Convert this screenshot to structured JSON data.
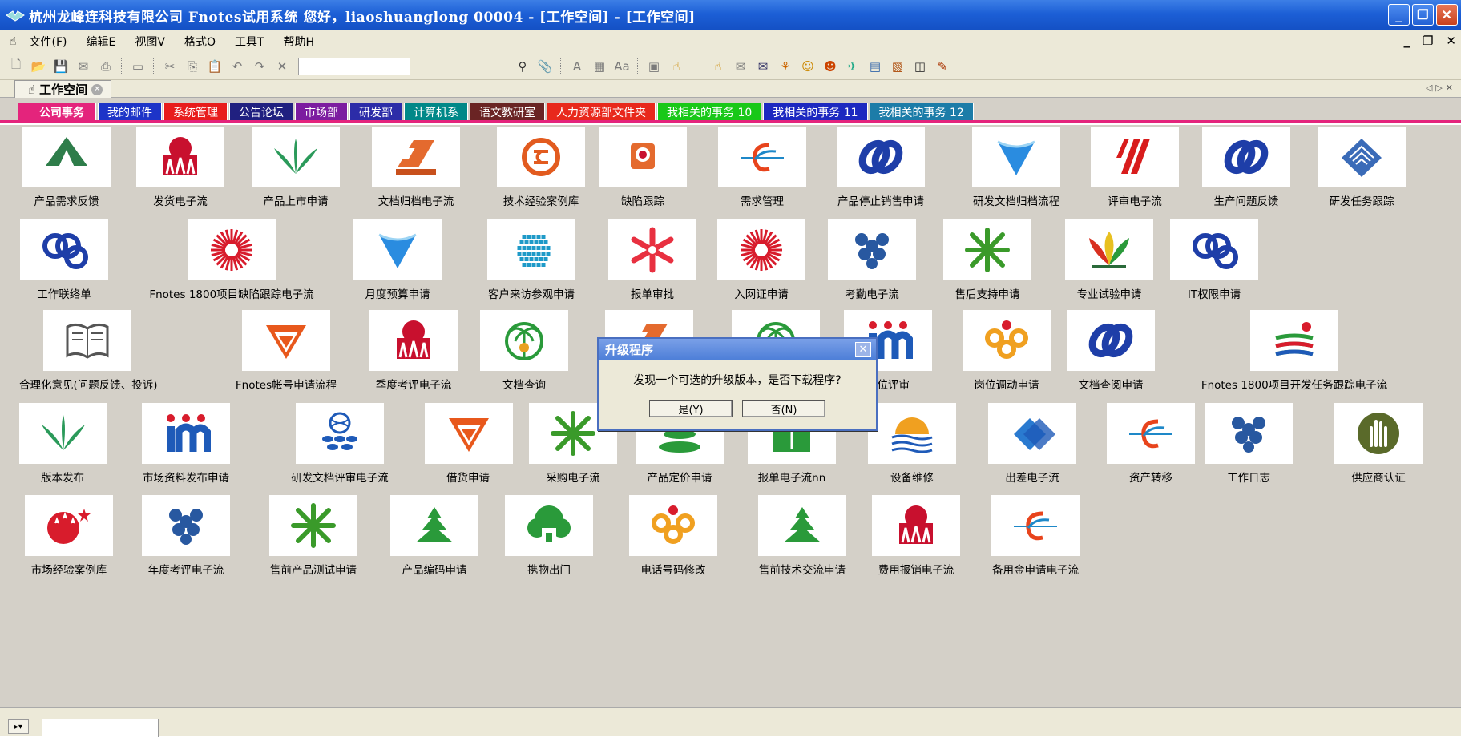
{
  "window": {
    "title": "杭州龙峰连科技有限公司 Fnotes试用系统 您好，liaoshuanglong 00004 - [工作空间] - [工作空间]"
  },
  "menu": [
    "文件(F)",
    "编辑E",
    "视图V",
    "格式O",
    "工具T",
    "帮助H"
  ],
  "doc_tab": "工作空间",
  "categories": [
    {
      "label": "公司事务",
      "color": "#e4247c"
    },
    {
      "label": "我的邮件",
      "color": "#1d34c8"
    },
    {
      "label": "系统管理",
      "color": "#e81c1c"
    },
    {
      "label": "公告论坛",
      "color": "#202080"
    },
    {
      "label": "市场部",
      "color": "#7c1ca0"
    },
    {
      "label": "研发部",
      "color": "#2c2ca8"
    },
    {
      "label": "计算机系",
      "color": "#008888"
    },
    {
      "label": "语文教研室",
      "color": "#6a2424"
    },
    {
      "label": "人力资源部文件夹",
      "color": "#e8281c"
    },
    {
      "label": "我相关的事务 10",
      "color": "#18c818"
    },
    {
      "label": "我相关的事务 11",
      "color": "#1c28c0"
    },
    {
      "label": "我相关的事务 12",
      "color": "#1c7ca8"
    }
  ],
  "rows": [
    [
      {
        "label": "产品需求反馈",
        "icon": "tree-logo-icon"
      },
      {
        "label": "发货电子流",
        "icon": "castle-logo-icon"
      },
      {
        "label": "产品上市申请",
        "icon": "leaves-logo-icon"
      },
      {
        "label": "文档归档电子流",
        "icon": "film-logo-icon"
      },
      {
        "label": "技术经验案例库",
        "icon": "ring-logo-icon"
      },
      {
        "label": "缺陷跟踪",
        "icon": "rose-logo-icon"
      },
      {
        "label": "需求管理",
        "icon": "wave-logo-icon"
      },
      {
        "label": "产品停止销售申请",
        "icon": "blue-rings-icon"
      },
      {
        "label": "研发文档归档流程",
        "icon": "blue-triangle-icon"
      },
      {
        "label": "评审电子流",
        "icon": "red-stripes-icon"
      },
      {
        "label": "生产问题反馈",
        "icon": "blue-rings-icon"
      },
      {
        "label": "研发任务跟踪",
        "icon": "blue-diamond-icon"
      }
    ],
    [
      {
        "label": "工作联络单",
        "icon": "triple-rings-icon"
      },
      {
        "label": "Fnotes 1800项目缺陷跟踪电子流",
        "icon": "sunburst-icon"
      },
      {
        "label": "月度预算申请",
        "icon": "blue-triangle-icon"
      },
      {
        "label": "客户来访参观申请",
        "icon": "dot-grid-icon"
      },
      {
        "label": "报单审批",
        "icon": "red-flower-icon"
      },
      {
        "label": "入网证申请",
        "icon": "sunburst-icon"
      },
      {
        "label": "考勤电子流",
        "icon": "grapes-icon"
      },
      {
        "label": "售后支持申请",
        "icon": "green-star-icon"
      },
      {
        "label": "专业试验申请",
        "icon": "lotus-icon"
      },
      {
        "label": "IT权限申请",
        "icon": "triple-rings-icon"
      }
    ],
    [
      {
        "label": "合理化意见(问题反馈、投诉)",
        "icon": "book-icon"
      },
      {
        "label": "Fnotes帐号申请流程",
        "icon": "orange-w-icon"
      },
      {
        "label": "季度考评电子流",
        "icon": "castle-logo-icon"
      },
      {
        "label": "文档查询",
        "icon": "palm-circle-icon"
      },
      {
        "label": "",
        "icon": "film-logo-icon"
      },
      {
        "label": "",
        "icon": "palm-circle-icon"
      },
      {
        "label": "岗位评审",
        "icon": "im-logo-icon"
      },
      {
        "label": "岗位调动申请",
        "icon": "knot-icon"
      },
      {
        "label": "文档查阅申请",
        "icon": "blue-rings-icon"
      },
      {
        "label": "Fnotes 1800项目开发任务跟踪电子流",
        "icon": "lines-logo-icon"
      }
    ],
    [
      {
        "label": "版本发布",
        "icon": "leaves-logo-icon"
      },
      {
        "label": "市场资料发布申请",
        "icon": "im-logo-icon"
      },
      {
        "label": "研发文档评审电子流",
        "icon": "globe-stack-icon"
      },
      {
        "label": "借货申请",
        "icon": "orange-w-icon"
      },
      {
        "label": "采购电子流",
        "icon": "green-star-icon"
      },
      {
        "label": "产品定价申请",
        "icon": "green-stack-icon"
      },
      {
        "label": "报单电子流nn",
        "icon": "green-square-icon"
      },
      {
        "label": "设备维修",
        "icon": "sun-sea-icon"
      },
      {
        "label": "出差电子流",
        "icon": "blue-squares-icon"
      },
      {
        "label": "资产转移",
        "icon": "wave-logo-icon"
      },
      {
        "label": "工作日志",
        "icon": "grapes-icon"
      },
      {
        "label": "供应商认证",
        "icon": "hand-icon"
      }
    ],
    [
      {
        "label": "市场经验案例库",
        "icon": "stars-ball-icon"
      },
      {
        "label": "年度考评电子流",
        "icon": "grapes-icon"
      },
      {
        "label": "售前产品测试申请",
        "icon": "green-star-icon"
      },
      {
        "label": "产品编码申请",
        "icon": "pine-icon"
      },
      {
        "label": "携物出门",
        "icon": "tree-house-icon"
      },
      {
        "label": "电话号码修改",
        "icon": "knot-icon"
      },
      {
        "label": "售前技术交流申请",
        "icon": "pine-icon"
      },
      {
        "label": "费用报销电子流",
        "icon": "castle-logo-icon"
      },
      {
        "label": "备用金申请电子流",
        "icon": "wave-logo-icon"
      }
    ]
  ],
  "dialog": {
    "title": "升级程序",
    "message": "发现一个可选的升级版本，是否下载程序?",
    "yes": "是(Y)",
    "no": "否(N)"
  }
}
